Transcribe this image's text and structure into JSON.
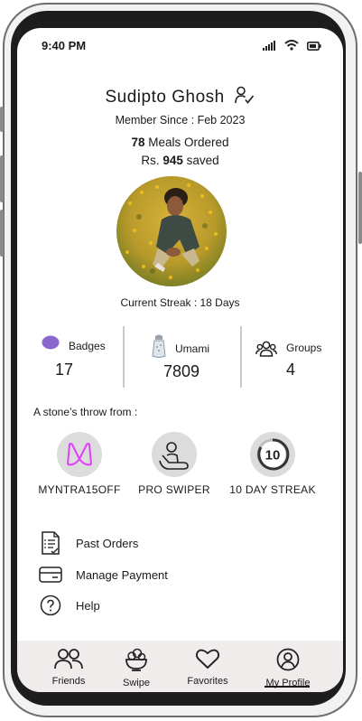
{
  "status_bar": {
    "time": "9:40 PM",
    "icons": [
      "signal-icon",
      "wifi-icon",
      "battery-icon"
    ]
  },
  "profile": {
    "name": "Sudipto Ghosh",
    "member_since": "Member Since : Feb 2023",
    "meals_count": "78",
    "meals_suffix": " Meals Ordered",
    "saved_prefix": "Rs. ",
    "saved_amount": "945",
    "saved_suffix": " saved",
    "current_streak": "Current Streak : 18 Days"
  },
  "stats": [
    {
      "label": "Badges",
      "value": "17",
      "icon": "badge-dot-icon",
      "icon_color": "#8b66cf"
    },
    {
      "label": "Umami",
      "value": "7809",
      "icon": "salt-shaker-icon"
    },
    {
      "label": "Groups",
      "value": "4",
      "icon": "groups-icon"
    }
  ],
  "stone_throw": {
    "title": "A stone’s throw from :",
    "badges": [
      {
        "name": "MYNTRA15OFF",
        "icon": "myntra-logo-icon",
        "color": "#e040fb"
      },
      {
        "name": "PRO SWIPER",
        "icon": "swiper-hand-icon"
      },
      {
        "name": "10 DAY STREAK",
        "icon": "streak-10-icon",
        "number": "10"
      }
    ]
  },
  "menu": [
    {
      "label": "Past Orders",
      "icon": "receipt-icon"
    },
    {
      "label": "Manage Payment",
      "icon": "card-icon"
    },
    {
      "label": "Help",
      "icon": "help-icon"
    }
  ],
  "nav": {
    "items": [
      {
        "label": "Friends",
        "icon": "friends-icon"
      },
      {
        "label": "Swipe",
        "icon": "bowl-icon"
      },
      {
        "label": "Favorites",
        "icon": "heart-icon"
      },
      {
        "label": "My Profile",
        "icon": "profile-icon",
        "active": true
      }
    ]
  }
}
